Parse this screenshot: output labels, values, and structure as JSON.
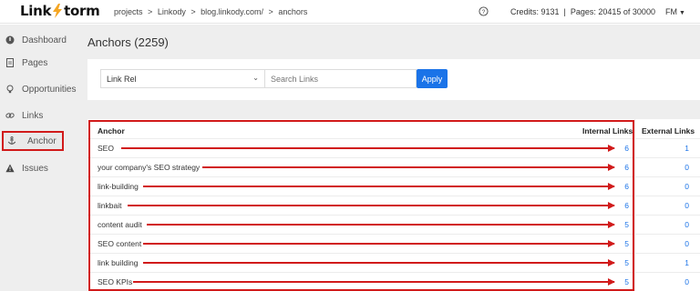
{
  "app": {
    "brand_left": "Link",
    "brand_right": "torm"
  },
  "breadcrumb": {
    "items": [
      "projects",
      ">",
      "Linkody",
      ">",
      "blog.linkody.com/",
      ">",
      "anchors"
    ]
  },
  "header": {
    "help_icon": "question-circle-icon",
    "credits_text": "Credits: 9131  |  Pages: 20415 of 30000",
    "user_initials": "FM"
  },
  "sidebar": {
    "items": [
      {
        "label": "Dashboard",
        "icon": "dashboard-icon"
      },
      {
        "label": "Pages",
        "icon": "page-icon"
      },
      {
        "label": "Opportunities",
        "icon": "lightbulb-icon"
      },
      {
        "label": "Links",
        "icon": "link-icon"
      },
      {
        "label": "Anchor",
        "icon": "anchor-icon",
        "active": true
      },
      {
        "label": "Issues",
        "icon": "warning-icon"
      }
    ]
  },
  "main": {
    "title": "Anchors (2259)",
    "filter": {
      "select_value": "Link Rel",
      "search_placeholder": "Search Links",
      "apply_label": "Apply"
    },
    "table": {
      "headers": {
        "anchor": "Anchor",
        "internal": "Internal Links",
        "external": "External Links"
      },
      "rows": [
        {
          "anchor": "SEO",
          "internal": "6",
          "external": "1"
        },
        {
          "anchor": "your company's SEO strategy",
          "internal": "6",
          "external": "0"
        },
        {
          "anchor": "link-building",
          "internal": "6",
          "external": "0"
        },
        {
          "anchor": "linkbait",
          "internal": "6",
          "external": "0"
        },
        {
          "anchor": "content audit",
          "internal": "5",
          "external": "0"
        },
        {
          "anchor": "SEO content",
          "internal": "5",
          "external": "0"
        },
        {
          "anchor": "link building",
          "internal": "5",
          "external": "1"
        },
        {
          "anchor": "SEO KPIs",
          "internal": "5",
          "external": "0"
        }
      ]
    }
  },
  "colors": {
    "accent": "#1a73e8",
    "annotation_red": "#d11a1a",
    "brand_bolt": "#f5a623"
  }
}
